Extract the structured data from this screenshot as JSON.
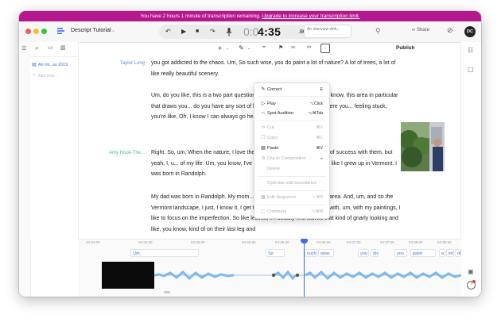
{
  "banner": {
    "text": "You have 2 hours 1 minute of transcription remaining.",
    "link": "Upgrade to increase your transcription limit."
  },
  "titlebar": {
    "doc_title": "Descript Tutorial",
    "time_prefix": "0:0",
    "time_main": "4:35",
    "time_frac": ".86",
    "interview_box": "An interview with...",
    "share_label": "Share",
    "avatar": "DC"
  },
  "sidebar": {
    "items": [
      {
        "label": "An int...ar 2019"
      },
      {
        "label": "Add new..."
      }
    ]
  },
  "toolbar": {
    "publish_label": "Publish"
  },
  "script": {
    "blocks": [
      {
        "speaker": "Taylor Long",
        "speaker_color": "#5b8fd9",
        "paragraphs": [
          "you got addicted to the chaos. Um, So such wise, you do paint a lot of nature? A lot of trees, a lot of like really beautiful scenery.",
          "Um, do you like, this is a two part question... nature in particular and you know, this area in particular that draws you... do you have any sort of local spots or favorite areas where you... feeling stuck, you're like, Oh, I know I can always go here."
        ]
      },
      {
        "speaker": "Amy Hook-The...",
        "speaker_color": "#48b98f",
        "paragraphs": [
          "Right. So, um, When the nature, I love the... trees in particular, a little bit of success with them, but yeah, I, u... of my life. Um, you know, I've always been outside growing... like I grew up in Vermont. I was born in Randolph.",
          "My dad was born in Randolph. My mom... back quite a bit, um, in, in the area. And, um, and so the Vermont landscape, I just, I know it, I get to know it a little bit better. And with, um, with my paintings, I like to focus on the imperfection. So like leaves, if I usually find leaves that kind of gnarly looking and like, you know, kind of on their last leg and"
        ]
      }
    ]
  },
  "context_menu": {
    "items": [
      {
        "label": "Correct",
        "shortcut": "E",
        "enabled": true
      },
      {
        "label": "Play",
        "shortcut": "⌥Click",
        "enabled": true
      },
      {
        "label": "Spot Audition",
        "shortcut": "⌥⌘Tab",
        "enabled": true
      },
      {
        "label": "Cut",
        "shortcut": "⌘X",
        "enabled": false
      },
      {
        "label": "Copy",
        "shortcut": "⌘C",
        "enabled": false
      },
      {
        "label": "Paste",
        "shortcut": "⌘V",
        "enabled": true
      },
      {
        "label": "Clip to Composition",
        "shortcut": "▸",
        "enabled": false
      },
      {
        "label": "Delete",
        "shortcut": "",
        "enabled": false
      },
      {
        "label": "Optimize edit boundaries",
        "shortcut": "",
        "enabled": false
      },
      {
        "label": "Edit Sequence",
        "shortcut": "⌥⌘D",
        "enabled": false
      },
      {
        "label": "Comment",
        "shortcut": "⌥⌘M",
        "enabled": false
      }
    ]
  },
  "timeline": {
    "timecodes": [
      "04:34.00",
      "04:34.50",
      "04:35.00",
      "04:35.50",
      "04:36.00",
      "04:36.50",
      "04:37.00",
      "04:37.50",
      "04:38.00",
      "04:38.50"
    ],
    "words": [
      "Um,",
      "So",
      "such",
      "wise,",
      "you",
      "do",
      "you",
      "paint",
      "a",
      "lot",
      "of"
    ]
  },
  "colors": {
    "banner_bg": "#b5178f",
    "accent": "#3a6df0",
    "waveform": "#7fb8ec"
  }
}
